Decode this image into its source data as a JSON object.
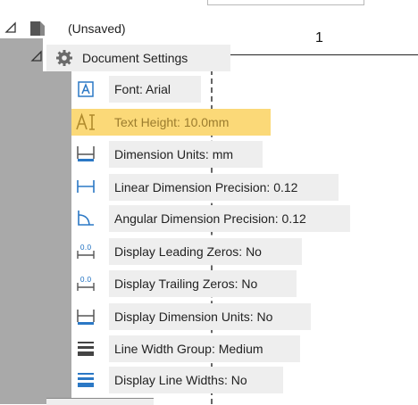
{
  "tree": {
    "root": {
      "label": "(Unsaved)"
    },
    "settings": {
      "label": "Document Settings"
    },
    "items": [
      {
        "label": "Font: Arial",
        "icon": "font-icon"
      },
      {
        "label": "Text Height: 10.0mm",
        "icon": "text-height-icon",
        "selected": true
      },
      {
        "label": "Dimension Units: mm",
        "icon": "dimension-units-icon"
      },
      {
        "label": "Linear Dimension Precision: 0.12",
        "icon": "linear-dimension-icon"
      },
      {
        "label": "Angular Dimension Precision: 0.12",
        "icon": "angular-dimension-icon"
      },
      {
        "label": "Display Leading Zeros: No",
        "icon": "leading-zeros-icon"
      },
      {
        "label": "Display Trailing Zeros: No",
        "icon": "trailing-zeros-icon"
      },
      {
        "label": "Display Dimension Units: No",
        "icon": "display-units-icon"
      },
      {
        "label": "Line Width Group: Medium",
        "icon": "line-width-group-icon"
      },
      {
        "label": "Display Line Widths: No",
        "icon": "line-widths-icon"
      }
    ]
  },
  "canvas": {
    "marker": "1"
  },
  "colors": {
    "highlight": "#fbd978",
    "accent_blue": "#2b78c5",
    "gutter": "#a9a9a9"
  }
}
